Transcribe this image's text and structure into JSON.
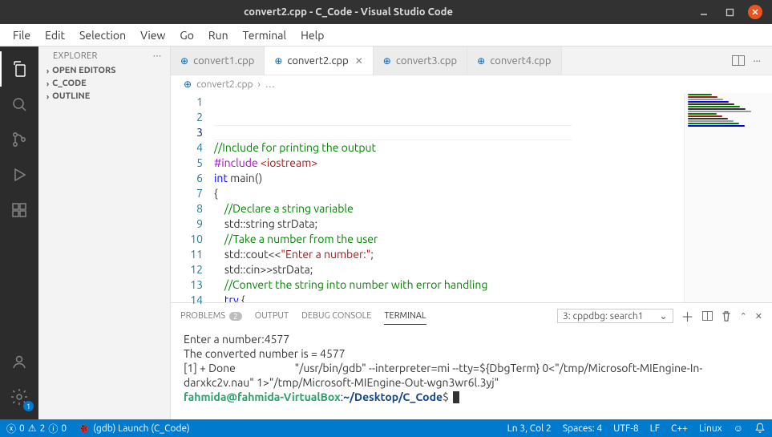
{
  "window": {
    "title": "convert2.cpp - C_Code - Visual Studio Code"
  },
  "menu": [
    "File",
    "Edit",
    "Selection",
    "View",
    "Go",
    "Run",
    "Terminal",
    "Help"
  ],
  "activitybar": {
    "settings_badge": "1"
  },
  "sidebar": {
    "title": "EXPLORER",
    "items": [
      "OPEN EDITORS",
      "C_CODE",
      "OUTLINE"
    ]
  },
  "tabs": [
    {
      "label": "convert1.cpp",
      "active": false
    },
    {
      "label": "convert2.cpp",
      "active": true
    },
    {
      "label": "convert3.cpp",
      "active": false
    },
    {
      "label": "convert4.cpp",
      "active": false
    }
  ],
  "breadcrumb": {
    "file": "convert2.cpp"
  },
  "code": {
    "lines": [
      {
        "n": "1",
        "seg": [
          [
            "c-comment",
            "//Include for printing the output"
          ]
        ]
      },
      {
        "n": "2",
        "seg": [
          [
            "c-pre",
            "#include"
          ],
          [
            "",
            " "
          ],
          [
            "c-include",
            "<iostream>"
          ]
        ]
      },
      {
        "n": "3",
        "seg": [
          [
            "",
            ""
          ]
        ]
      },
      {
        "n": "4",
        "seg": [
          [
            "c-keyword",
            "int"
          ],
          [
            "",
            " main()"
          ]
        ]
      },
      {
        "n": "5",
        "seg": [
          [
            "",
            "{"
          ]
        ]
      },
      {
        "n": "6",
        "seg": [
          [
            "",
            "    "
          ],
          [
            "c-comment",
            "//Declare a string variable"
          ]
        ]
      },
      {
        "n": "7",
        "seg": [
          [
            "",
            "    std::string strData;"
          ]
        ]
      },
      {
        "n": "8",
        "seg": [
          [
            "",
            ""
          ]
        ]
      },
      {
        "n": "9",
        "seg": [
          [
            "",
            "    "
          ],
          [
            "c-comment",
            "//Take a number from the user"
          ]
        ]
      },
      {
        "n": "10",
        "seg": [
          [
            "",
            "    std::cout<<"
          ],
          [
            "c-string",
            "\"Enter a number:\""
          ],
          [
            "",
            ";"
          ]
        ]
      },
      {
        "n": "11",
        "seg": [
          [
            "",
            "    std::cin>>strData;"
          ]
        ]
      },
      {
        "n": "12",
        "seg": [
          [
            "",
            ""
          ]
        ]
      },
      {
        "n": "13",
        "seg": [
          [
            "",
            "    "
          ],
          [
            "c-comment",
            "//Convert the string into number with error handling"
          ]
        ]
      },
      {
        "n": "14",
        "seg": [
          [
            "",
            "    "
          ],
          [
            "c-keyword",
            "try"
          ],
          [
            "",
            " {"
          ]
        ]
      }
    ],
    "current_line": 3
  },
  "panel": {
    "tabs": {
      "problems": "PROBLEMS",
      "problems_count": "2",
      "output": "OUTPUT",
      "debug": "DEBUG CONSOLE",
      "terminal": "TERMINAL"
    },
    "terminal_select": "3: cppdbg: search1",
    "terminal_lines": [
      "",
      "Enter a number:4577",
      "The converted number is = 4577",
      "[1] + Done                       \"/usr/bin/gdb\" --interpreter=mi --tty=${DbgTerm} 0<\"/tmp/Microsoft-MIEngine-In-darxkc2v.nau\" 1>\"/tmp/Microsoft-MIEngine-Out-wgn3wr6l.3yj\""
    ],
    "prompt": {
      "user": "fahmida@fahmida-VirtualBox",
      "sep": ":",
      "path": "~/Desktop/C_Code",
      "end": "$ "
    }
  },
  "status": {
    "errors": "0",
    "warnings": "2",
    "hints": "0",
    "launch": "(gdb) Launch (C_Code)",
    "ln_col": "Ln 3, Col 2",
    "spaces": "Spaces: 4",
    "encoding": "UTF-8",
    "eol": "LF",
    "lang": "C++",
    "os": "Linux"
  }
}
